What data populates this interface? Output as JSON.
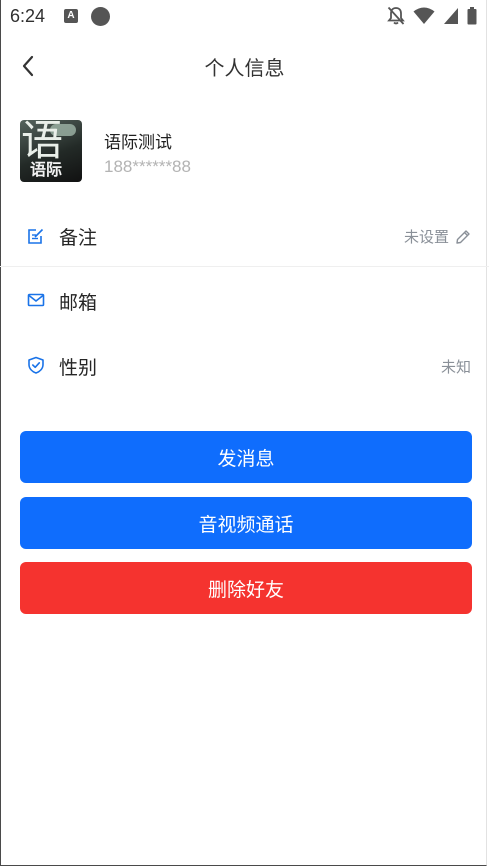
{
  "status_bar": {
    "time": "6:24",
    "notification_letter": "A"
  },
  "header": {
    "title": "个人信息",
    "back_icon": "chevron-left-icon"
  },
  "profile": {
    "avatar_text_big": "语",
    "avatar_text_small": "语际",
    "name": "语际测试",
    "phone": "188******88"
  },
  "info_rows": [
    {
      "icon": "note-edit-icon",
      "label": "备注",
      "value": "未设置",
      "value_icon": "pencil-icon"
    },
    {
      "icon": "mail-icon",
      "label": "邮箱",
      "value": ""
    },
    {
      "icon": "shield-check-icon",
      "label": "性别",
      "value": "未知"
    }
  ],
  "actions": {
    "send_message": "发消息",
    "av_call": "音视频通话",
    "delete_friend": "删除好友"
  },
  "colors": {
    "accent": "#0f6dfd",
    "danger": "#f5332f",
    "icon_blue": "#1a73e8"
  }
}
